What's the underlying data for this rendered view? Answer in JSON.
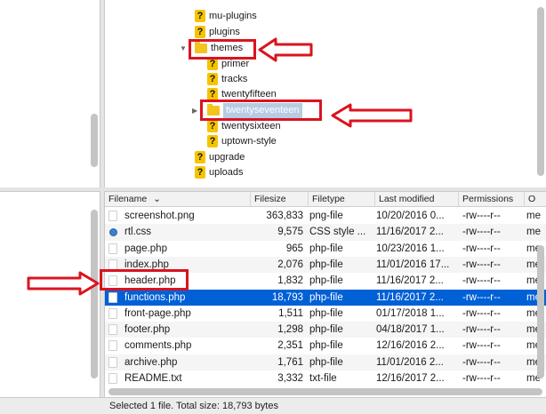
{
  "remote_tree": {
    "items": [
      {
        "label": "mu-plugins",
        "icon": "question-folder-icon"
      },
      {
        "label": "plugins",
        "icon": "question-folder-icon"
      },
      {
        "label": "themes",
        "icon": "folder-icon",
        "expanded": true
      },
      {
        "label": "primer",
        "icon": "question-folder-icon"
      },
      {
        "label": "tracks",
        "icon": "question-folder-icon"
      },
      {
        "label": "twentyfifteen",
        "icon": "question-folder-icon"
      },
      {
        "label": "twentyseventeen",
        "icon": "folder-icon",
        "selected": true
      },
      {
        "label": "twentysixteen",
        "icon": "question-folder-icon"
      },
      {
        "label": "uptown-style",
        "icon": "question-folder-icon"
      },
      {
        "label": "upgrade",
        "icon": "question-folder-icon"
      },
      {
        "label": "uploads",
        "icon": "question-folder-icon"
      }
    ]
  },
  "file_list": {
    "columns": [
      "Filename",
      "Filesize",
      "Filetype",
      "Last modified",
      "Permissions",
      "O"
    ],
    "rows": [
      {
        "name": "screenshot.png",
        "size": "363,833",
        "type": "png-file",
        "modified": "10/20/2016 0...",
        "perms": "-rw----r--",
        "owner": "me"
      },
      {
        "name": "rtl.css",
        "size": "9,575",
        "type": "CSS style ...",
        "modified": "11/16/2017 2...",
        "perms": "-rw----r--",
        "owner": "me"
      },
      {
        "name": "page.php",
        "size": "965",
        "type": "php-file",
        "modified": "10/23/2016 1...",
        "perms": "-rw----r--",
        "owner": "me"
      },
      {
        "name": "index.php",
        "size": "2,076",
        "type": "php-file",
        "modified": "11/01/2016 17...",
        "perms": "-rw----r--",
        "owner": "me"
      },
      {
        "name": "header.php",
        "size": "1,832",
        "type": "php-file",
        "modified": "11/16/2017 2...",
        "perms": "-rw----r--",
        "owner": "me"
      },
      {
        "name": "functions.php",
        "size": "18,793",
        "type": "php-file",
        "modified": "11/16/2017 2...",
        "perms": "-rw----r--",
        "owner": "me"
      },
      {
        "name": "front-page.php",
        "size": "1,511",
        "type": "php-file",
        "modified": "01/17/2018 1...",
        "perms": "-rw----r--",
        "owner": "me"
      },
      {
        "name": "footer.php",
        "size": "1,298",
        "type": "php-file",
        "modified": "04/18/2017 1...",
        "perms": "-rw----r--",
        "owner": "me"
      },
      {
        "name": "comments.php",
        "size": "2,351",
        "type": "php-file",
        "modified": "12/16/2016 2...",
        "perms": "-rw----r--",
        "owner": "me"
      },
      {
        "name": "archive.php",
        "size": "1,761",
        "type": "php-file",
        "modified": "11/01/2016 2...",
        "perms": "-rw----r--",
        "owner": "me"
      },
      {
        "name": "README.txt",
        "size": "3,332",
        "type": "txt-file",
        "modified": "12/16/2017 2...",
        "perms": "-rw----r--",
        "owner": "me"
      }
    ]
  },
  "status_bar": {
    "text": "Selected 1 file. Total size: 18,793 bytes"
  },
  "colors": {
    "selection": "#0060d6",
    "annotation": "#d9141e",
    "folder": "#f3c320"
  }
}
